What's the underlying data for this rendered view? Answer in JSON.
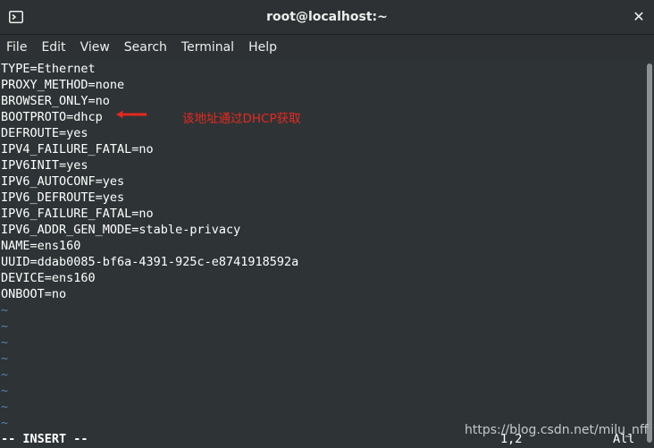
{
  "window": {
    "title": "root@localhost:~"
  },
  "menu": [
    "File",
    "Edit",
    "View",
    "Search",
    "Terminal",
    "Help"
  ],
  "file_lines": [
    "TYPE=Ethernet",
    "PROXY_METHOD=none",
    "BROWSER_ONLY=no",
    "BOOTPROTO=dhcp",
    "DEFROUTE=yes",
    "IPV4_FAILURE_FATAL=no",
    "IPV6INIT=yes",
    "IPV6_AUTOCONF=yes",
    "IPV6_DEFROUTE=yes",
    "IPV6_FAILURE_FATAL=no",
    "IPV6_ADDR_GEN_MODE=stable-privacy",
    "NAME=ens160",
    "UUID=ddab0085-bf6a-4391-925c-e8741918592a",
    "DEVICE=ens160",
    "ONBOOT=no"
  ],
  "tilde": "~",
  "annotation": "该地址通过DHCP获取",
  "status": {
    "mode": "-- INSERT --",
    "position": "1,2",
    "scroll": "All"
  },
  "watermark": "https://blog.csdn.net/milu_nff",
  "colors": {
    "annotation": "#e8281e",
    "tilde": "#5a7fb3",
    "background": "#2e3436"
  }
}
